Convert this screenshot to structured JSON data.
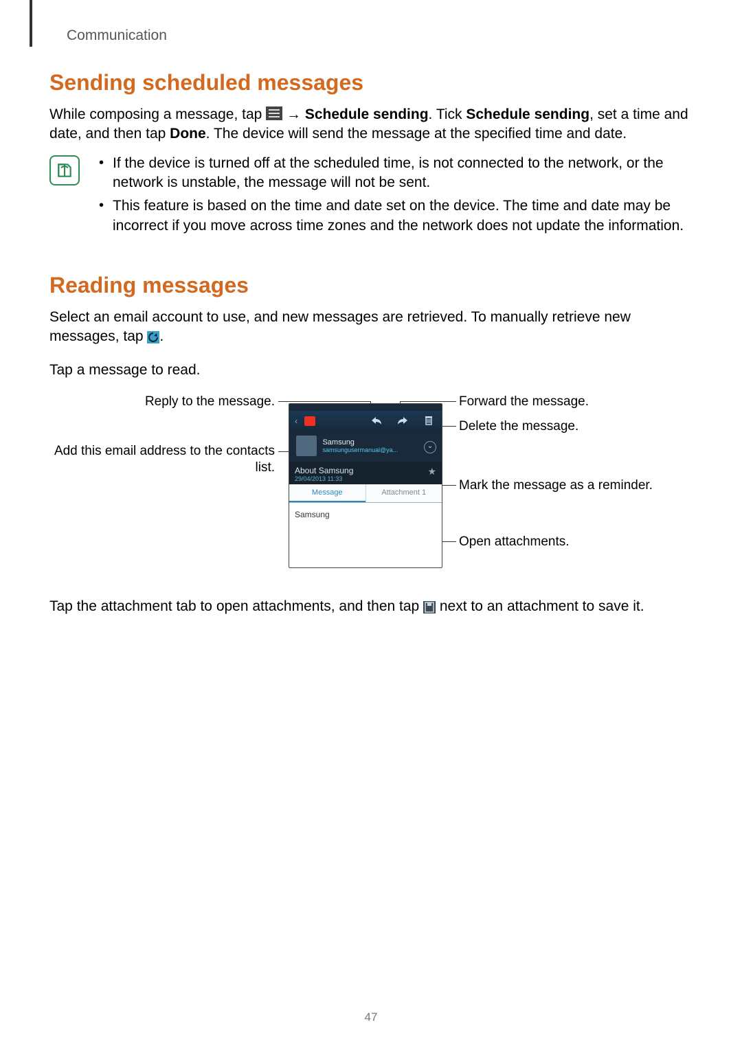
{
  "page": {
    "section": "Communication",
    "number": "47"
  },
  "sec1": {
    "heading": "Sending scheduled messages",
    "para_prefix": "While composing a message, tap ",
    "arrow": " → ",
    "bold1": "Schedule sending",
    "mid": ". Tick ",
    "bold2": "Schedule sending",
    "mid2": ", set a time and date, and then tap ",
    "bold3": "Done",
    "suffix": ". The device will send the message at the specified time and date.",
    "notes": [
      "If the device is turned off at the scheduled time, is not connected to the network, or the network is unstable, the message will not be sent.",
      "This feature is based on the time and date set on the device. The time and date may be incorrect if you move across time zones and the network does not update the information."
    ]
  },
  "sec2": {
    "heading": "Reading messages",
    "para1_prefix": "Select an email account to use, and new messages are retrieved. To manually retrieve new messages, tap ",
    "para1_suffix": ".",
    "para2": "Tap a message to read.",
    "para3_prefix": "Tap the attachment tab to open attachments, and then tap ",
    "para3_suffix": " next to an attachment to save it."
  },
  "callouts": {
    "reply": "Reply to the message.",
    "add_contact": "Add this email address to the contacts list.",
    "forward": "Forward the message.",
    "delete": "Delete the message.",
    "mark_reminder": "Mark the message as a reminder.",
    "open_attachments": "Open attachments."
  },
  "phone": {
    "sender_name": "Samsung",
    "sender_email": "samsungusermanual@ya...",
    "subject": "About Samsung",
    "date": "29/04/2013  11:33",
    "tab_message": "Message",
    "tab_attachment": "Attachment 1",
    "body_text": "Samsung"
  }
}
